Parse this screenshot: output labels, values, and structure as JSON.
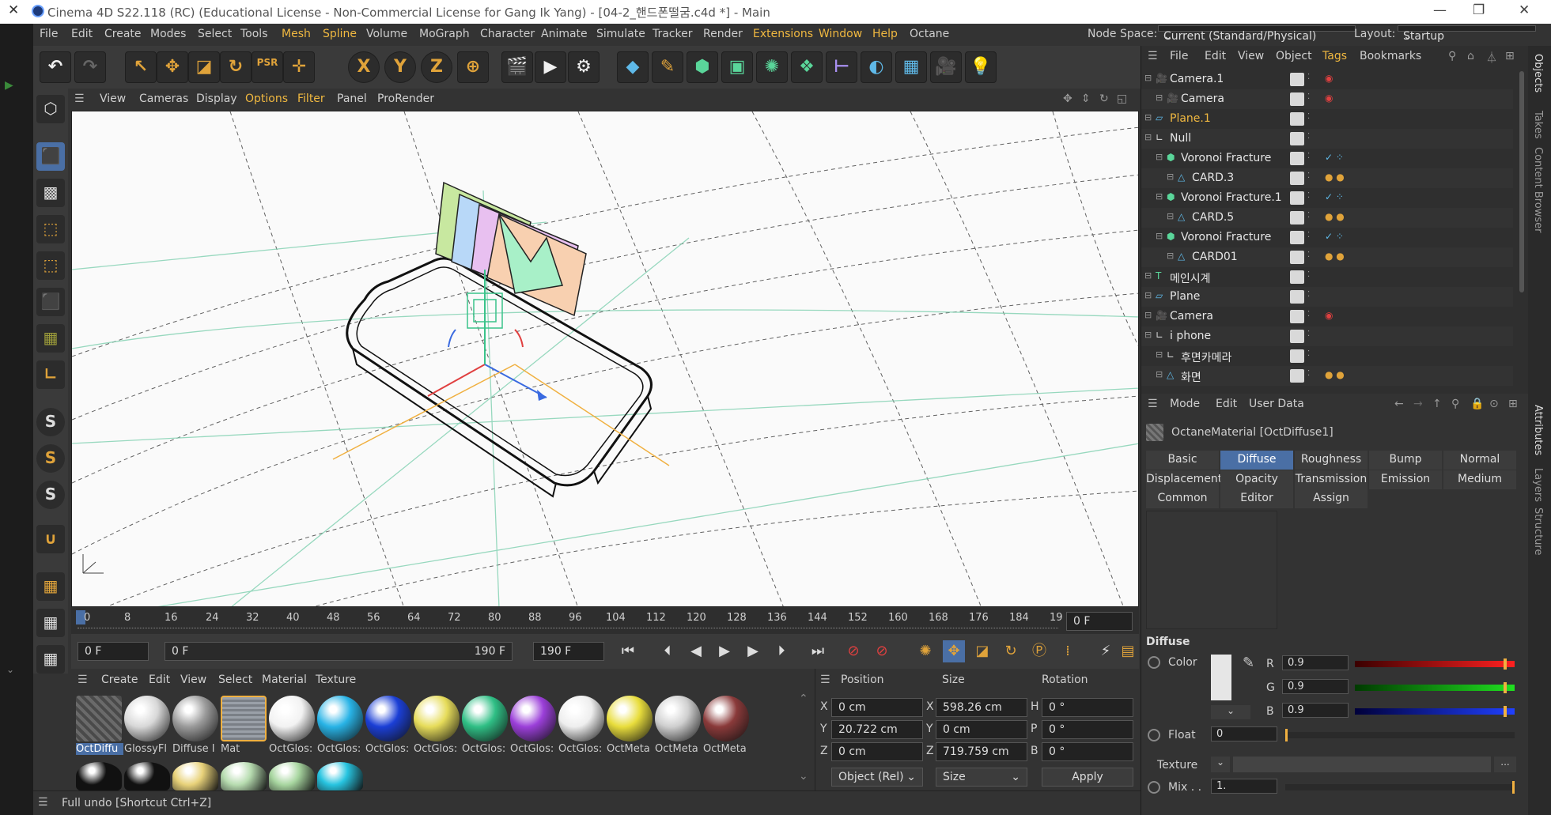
{
  "window": {
    "title": "Cinema 4D S22.118 (RC) (Educational License - Non-Commercial License for Gang Ik Yang) - [04-2_핸드폰떨굼.c4d *] - Main",
    "close_left": "✕",
    "minimize": "—",
    "restore": "❐",
    "close": "✕"
  },
  "menubar": {
    "items": [
      "File",
      "Edit",
      "Create",
      "Modes",
      "Select",
      "Tools",
      "Mesh",
      "Spline",
      "Volume",
      "MoGraph",
      "Character",
      "Animate",
      "Simulate",
      "Tracker",
      "Render",
      "Extensions",
      "Window",
      "Help",
      "Octane"
    ],
    "node_space_label": "Node Space:",
    "node_space_value": "Current (Standard/Physical)",
    "layout_label": "Layout:",
    "layout_value": "Startup"
  },
  "toolbar": {
    "xyz": [
      "X",
      "Y",
      "Z"
    ],
    "psr": "PSR"
  },
  "viewport": {
    "menu": [
      "View",
      "Cameras",
      "Display",
      "Options",
      "Filter",
      "Panel",
      "ProRender"
    ]
  },
  "timeline": {
    "ticks": [
      "0",
      "8",
      "16",
      "24",
      "32",
      "40",
      "48",
      "56",
      "64",
      "72",
      "80",
      "88",
      "96",
      "104",
      "112",
      "120",
      "128",
      "136",
      "144",
      "152",
      "160",
      "168",
      "176",
      "184",
      "19"
    ],
    "current_frame": "0 F"
  },
  "playback": {
    "start": "0 F",
    "min": "0 F",
    "max": "190 F",
    "end": "190 F"
  },
  "materials": {
    "menu": [
      "Create",
      "Edit",
      "View",
      "Select",
      "Material",
      "Texture"
    ],
    "items": [
      {
        "label": "OctDiffu",
        "color": "#555555"
      },
      {
        "label": "GlossyFl",
        "color": "#d8d8d8"
      },
      {
        "label": "Diffuse I",
        "color": "#9a9a9a"
      },
      {
        "label": "Mat",
        "color": "#8a8f96"
      },
      {
        "label": "OctGlos:",
        "color": "#f2f2f2"
      },
      {
        "label": "OctGlos:",
        "color": "#28b3e6"
      },
      {
        "label": "OctGlos:",
        "color": "#1b3fd6"
      },
      {
        "label": "OctGlos:",
        "color": "#e6dc5a"
      },
      {
        "label": "OctGlos:",
        "color": "#2fbf85"
      },
      {
        "label": "OctGlos:",
        "color": "#9b3fd9"
      },
      {
        "label": "OctGlos:",
        "color": "#eeeeee"
      },
      {
        "label": "OctMeta",
        "color": "#e8dd3c"
      },
      {
        "label": "OctMeta",
        "color": "#cfcfcf"
      },
      {
        "label": "OctMeta",
        "color": "#8a3a3a"
      }
    ],
    "row2_colors": [
      "#111111",
      "#111111",
      "#e8d27a",
      "#b7dcb0",
      "#a8d6a0",
      "#27c4e0"
    ]
  },
  "coords": {
    "headers": [
      "Position",
      "Size",
      "Rotation"
    ],
    "rows": [
      {
        "axis": "X",
        "pos": "0 cm",
        "size_axis": "X",
        "size": "598.26 cm",
        "rot_axis": "H",
        "rot": "0 °"
      },
      {
        "axis": "Y",
        "pos": "20.722 cm",
        "size_axis": "Y",
        "size": "0 cm",
        "rot_axis": "P",
        "rot": "0 °"
      },
      {
        "axis": "Z",
        "pos": "0 cm",
        "size_axis": "Z",
        "size": "719.759 cm",
        "rot_axis": "B",
        "rot": "0 °"
      }
    ],
    "mode": "Object (Rel)",
    "size_mode": "Size",
    "apply": "Apply"
  },
  "status": "Full undo [Shortcut Ctrl+Z]",
  "objects": {
    "menu": [
      "File",
      "Edit",
      "View",
      "Object",
      "Tags",
      "Bookmarks"
    ],
    "rows": [
      {
        "name": "Camera.1",
        "indent": 0,
        "icon": "camera-icon",
        "highlight": false
      },
      {
        "name": "Camera",
        "indent": 1,
        "icon": "camera-icon",
        "highlight": false
      },
      {
        "name": "Plane.1",
        "indent": 0,
        "icon": "plane-icon",
        "highlight": true
      },
      {
        "name": "Null",
        "indent": 0,
        "icon": "null-icon",
        "highlight": false
      },
      {
        "name": "Voronoi Fracture",
        "indent": 1,
        "icon": "voronoi-icon",
        "highlight": false
      },
      {
        "name": "CARD.3",
        "indent": 2,
        "icon": "poly-icon",
        "highlight": false
      },
      {
        "name": "Voronoi Fracture.1",
        "indent": 1,
        "icon": "voronoi-icon",
        "highlight": false
      },
      {
        "name": "CARD.5",
        "indent": 2,
        "icon": "poly-icon",
        "highlight": false
      },
      {
        "name": "Voronoi Fracture",
        "indent": 1,
        "icon": "voronoi-icon",
        "highlight": false
      },
      {
        "name": "CARD01",
        "indent": 2,
        "icon": "poly-icon",
        "highlight": false
      },
      {
        "name": "메인시계",
        "indent": 0,
        "icon": "text-icon",
        "highlight": false
      },
      {
        "name": "Plane",
        "indent": 0,
        "icon": "plane-icon",
        "highlight": false
      },
      {
        "name": "Camera",
        "indent": 0,
        "icon": "camera-icon",
        "highlight": false
      },
      {
        "name": "i phone",
        "indent": 0,
        "icon": "null-icon",
        "highlight": false
      },
      {
        "name": "후면카메라",
        "indent": 1,
        "icon": "null-icon",
        "highlight": false
      },
      {
        "name": "화면",
        "indent": 1,
        "icon": "poly-icon",
        "highlight": false
      }
    ]
  },
  "attributes": {
    "menu": [
      "Mode",
      "Edit",
      "User Data"
    ],
    "material_name": "OctaneMaterial [OctDiffuse1]",
    "tabs_row1": [
      "Basic",
      "Diffuse",
      "Roughness",
      "Bump",
      "Normal"
    ],
    "tabs_row2": [
      "Displacement",
      "Opacity",
      "Transmission",
      "Emission",
      "Medium"
    ],
    "tabs_row3": [
      "Common",
      "Editor",
      "Assign"
    ],
    "active_tab": "Diffuse",
    "section": "Diffuse",
    "color_label": "Color",
    "r_label": "R",
    "r": "0.9",
    "g_label": "G",
    "g": "0.9",
    "b_label": "B",
    "b": "0.9",
    "float_label": "Float",
    "float": "0",
    "texture_label": "Texture",
    "texture_btn": "...",
    "mix_label": "Mix . .",
    "mix": "1."
  },
  "right_tabs": [
    "Objects",
    "Takes",
    "Content Browser",
    "Attributes",
    "Layers",
    "Structure"
  ]
}
